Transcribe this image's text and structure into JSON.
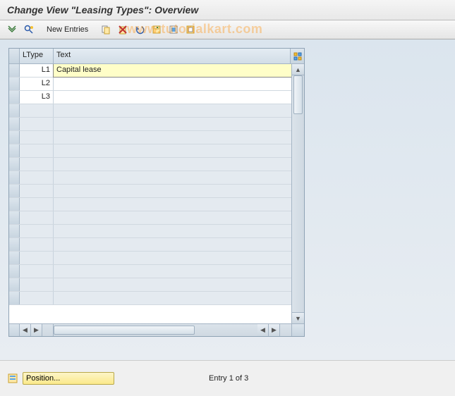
{
  "title": "Change View \"Leasing Types\": Overview",
  "watermark": "www.tutorialkart.com",
  "toolbar": {
    "new_entries_label": "New Entries"
  },
  "table": {
    "columns": {
      "ltype": "LType",
      "text": "Text"
    },
    "rows": [
      {
        "ltype": "L1",
        "text": "Capital lease",
        "active": true
      },
      {
        "ltype": "L2",
        "text": ""
      },
      {
        "ltype": "L3",
        "text": ""
      }
    ],
    "empty_row_count": 15
  },
  "footer": {
    "position_label": "Position...",
    "entry_status": "Entry 1 of 3"
  }
}
